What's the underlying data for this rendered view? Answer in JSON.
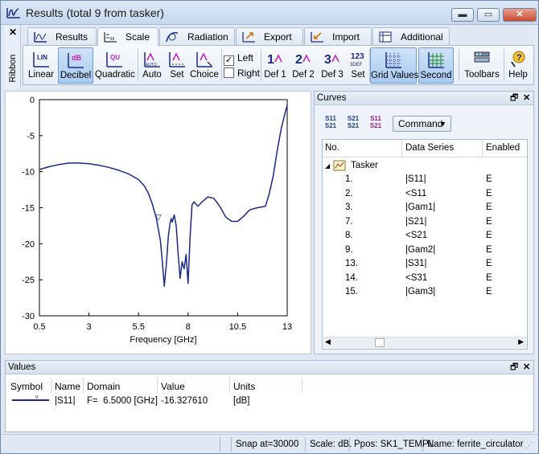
{
  "window": {
    "title": "Results (total 9 from tasker)",
    "minimize": "▬",
    "maximize": "▭",
    "close": "✕"
  },
  "ribbon": {
    "side_label": "Ribbon",
    "close": "✕",
    "tabs": [
      {
        "label": "Results",
        "icon": "results-icon"
      },
      {
        "label": "Scale",
        "icon": "scale-icon"
      },
      {
        "label": "Radiation",
        "icon": "radiation-icon"
      },
      {
        "label": "Export",
        "icon": "export-icon"
      },
      {
        "label": "Import",
        "icon": "import-icon"
      },
      {
        "label": "Additional",
        "icon": "additional-icon"
      }
    ],
    "active_tab": "Scale",
    "buttons": {
      "linear": "Linear",
      "decibel": "Decibel",
      "quadratic": "Quadratic",
      "auto": "Auto",
      "set": "Set",
      "choice": "Choice",
      "left": "Left",
      "right": "Right",
      "def1": "Def 1",
      "def2": "Def 2",
      "def3": "Def 3",
      "set2": "Set",
      "grid_values": "Grid Values",
      "second": "Second",
      "toolbars": "Toolbars",
      "help": "Help"
    },
    "icon_text": {
      "lin": "LIN",
      "db": "dB",
      "qu": "QU",
      "auto": "AUTO",
      "def3": "3DEF"
    },
    "left_checked": true,
    "right_checked": false
  },
  "chart_data": {
    "type": "line",
    "xlabel": "Frequency [GHz]",
    "ylabel": "",
    "xlim": [
      0.5,
      13
    ],
    "ylim": [
      -30,
      0
    ],
    "xticks": [
      "0.5",
      "3",
      "5.5",
      "8",
      "10.5",
      "13"
    ],
    "yticks": [
      "0",
      "-5",
      "-10",
      "-15",
      "-20",
      "-25",
      "-30"
    ],
    "grid": false,
    "series": [
      {
        "color": "#1a2a8a",
        "x": [
          0.5,
          1.0,
          1.5,
          2.0,
          2.5,
          3.0,
          3.5,
          4.0,
          4.5,
          5.0,
          5.5,
          5.8,
          6.0,
          6.2,
          6.4,
          6.6,
          6.7,
          6.8,
          6.9,
          7.0,
          7.1,
          7.15,
          7.2,
          7.3,
          7.4,
          7.5,
          7.6,
          7.7,
          7.8,
          7.9,
          8.0,
          8.1,
          8.2,
          8.3,
          8.5,
          8.7,
          9.0,
          9.3,
          9.6,
          9.9,
          10.2,
          10.5,
          10.8,
          11.1,
          11.5,
          11.9,
          12.1,
          12.3,
          12.5,
          12.7,
          12.9,
          13.0
        ],
        "y": [
          -9.7,
          -9.3,
          -9.0,
          -8.8,
          -8.8,
          -8.9,
          -9.1,
          -9.4,
          -9.8,
          -10.3,
          -11.1,
          -12.0,
          -13.0,
          -14.5,
          -16.5,
          -19.5,
          -22.5,
          -25.9,
          -23.0,
          -19.0,
          -17.0,
          -16.5,
          -17.0,
          -16.0,
          -17.5,
          -21.5,
          -24.8,
          -22.5,
          -23.5,
          -21.5,
          -25.5,
          -19.0,
          -14.6,
          -14.2,
          -14.8,
          -14.2,
          -13.5,
          -13.7,
          -14.8,
          -16.3,
          -16.9,
          -16.9,
          -16.2,
          -15.3,
          -15.0,
          -14.8,
          -13.0,
          -10.5,
          -7.0,
          -4.0,
          -1.8,
          -0.8
        ]
      }
    ],
    "marker": {
      "label": "▽",
      "x": 6.5,
      "y": -16.33
    }
  },
  "curves": {
    "title": "Curves",
    "command_label": "Command",
    "icons": [
      {
        "top": "S11",
        "bottom": "S21"
      },
      {
        "top": "S21",
        "bottom": "S21"
      },
      {
        "top": "S11",
        "bottom": "S21"
      }
    ],
    "headers": {
      "no": "No.",
      "series": "Data Series",
      "enabled": "Enabled"
    },
    "group": "Tasker",
    "rows": [
      {
        "no": "1.",
        "series": "|S11|",
        "enabled": "E"
      },
      {
        "no": "2.",
        "series": "<S11",
        "enabled": "E"
      },
      {
        "no": "3.",
        "series": "|Gam1|",
        "enabled": "E"
      },
      {
        "no": "7.",
        "series": "|S21|",
        "enabled": "E"
      },
      {
        "no": "8.",
        "series": "<S21",
        "enabled": "E"
      },
      {
        "no": "9.",
        "series": "|Gam2|",
        "enabled": "E"
      },
      {
        "no": "13.",
        "series": "|S31|",
        "enabled": "E"
      },
      {
        "no": "14.",
        "series": "<S31",
        "enabled": "E"
      },
      {
        "no": "15.",
        "series": "|Gam3|",
        "enabled": "E"
      }
    ]
  },
  "values": {
    "title": "Values",
    "headers": {
      "symbol": "Symbol",
      "name": "Name",
      "domain": "Domain",
      "value": "Value",
      "units": "Units"
    },
    "row": {
      "marker": "v",
      "name": "|S11|",
      "domain": "F=  6.5000 [GHz]",
      "value": "-16.327610",
      "units": "[dB]"
    }
  },
  "status": {
    "snap": "Snap at=30000",
    "scale": "Scale: dB.",
    "ppos": "Ppos: SK1_TEMPL",
    "name": "Name: ferrite_circulator"
  }
}
